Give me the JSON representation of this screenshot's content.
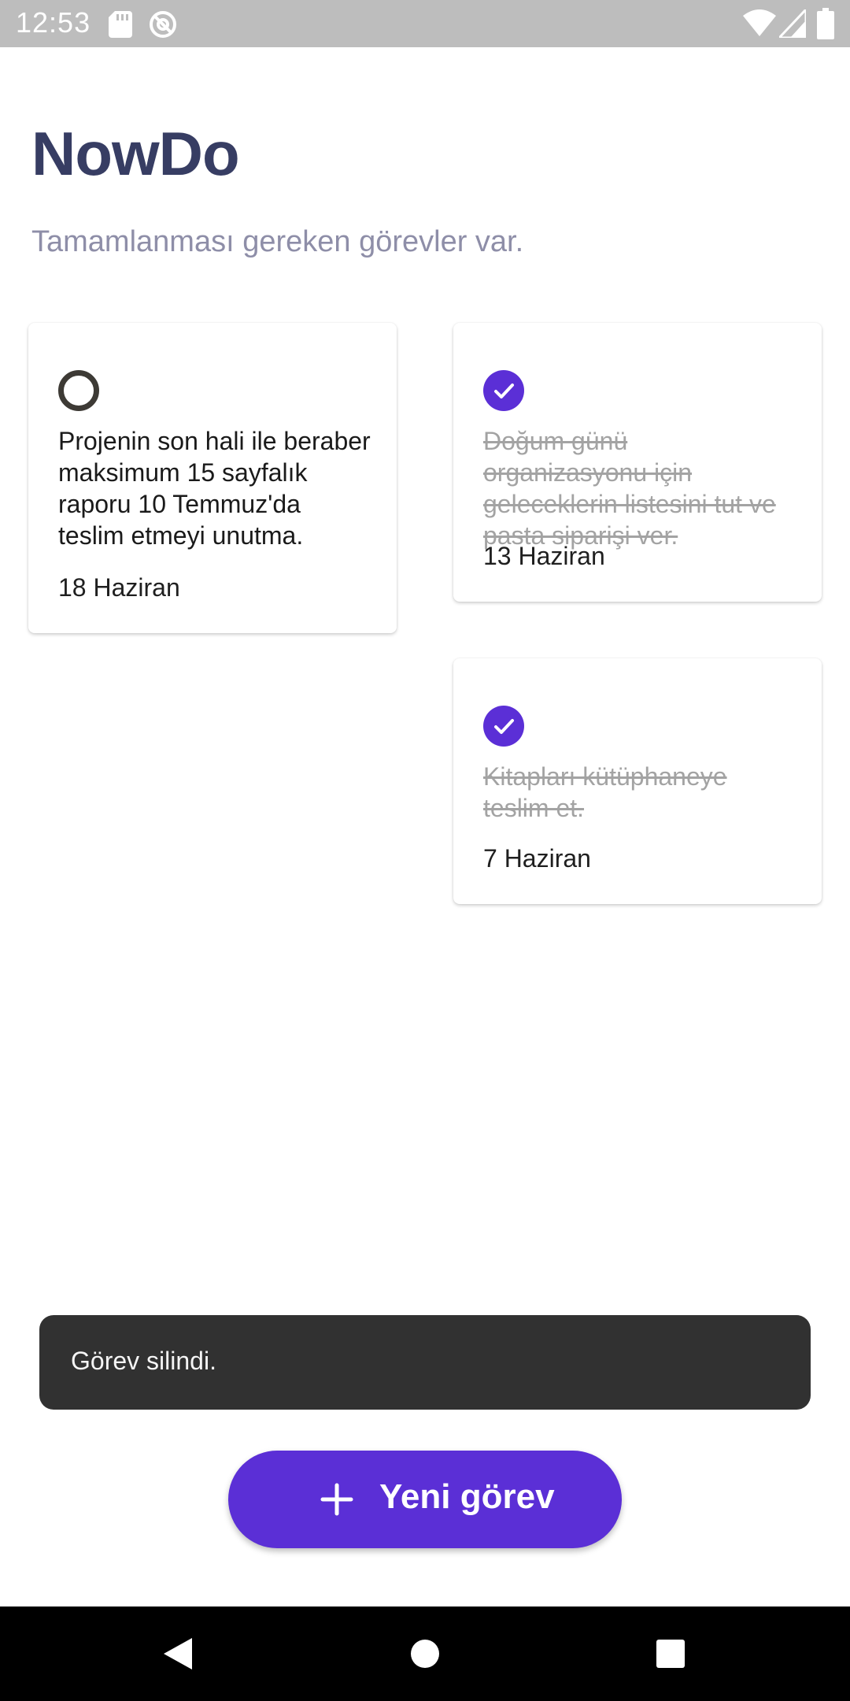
{
  "status_bar": {
    "time": "12:53",
    "icons": [
      "sd-card-icon",
      "sync-icon",
      "wifi-icon",
      "signal-icon",
      "battery-icon"
    ]
  },
  "header": {
    "title": "NowDo",
    "subtitle": "Tamamlanması gereken görevler var."
  },
  "tasks": [
    {
      "text": "Projenin son hali ile beraber maksimum 15 sayfalık raporu 10 Temmuz'da teslim etmeyi unutma.",
      "date": "18 Haziran",
      "completed": false
    },
    {
      "text": "Doğum günü organizasyonu için geleceklerin listesini tut ve pasta siparişi ver.",
      "date": "13 Haziran",
      "completed": true
    },
    {
      "text": "Kitapları kütüphaneye teslim et.",
      "date": "7 Haziran",
      "completed": true
    }
  ],
  "snackbar": {
    "message": "Görev silindi."
  },
  "fab": {
    "label": "Yeni görev",
    "icon": "plus-icon"
  },
  "nav_bar": {
    "icons": [
      "back-icon",
      "home-icon",
      "recents-icon"
    ]
  },
  "colors": {
    "accent": "#5b2fd6",
    "title": "#373d63",
    "subtitle": "#8e8ea8",
    "status_bar": "#bdbdbd",
    "snackbar": "#313131"
  }
}
